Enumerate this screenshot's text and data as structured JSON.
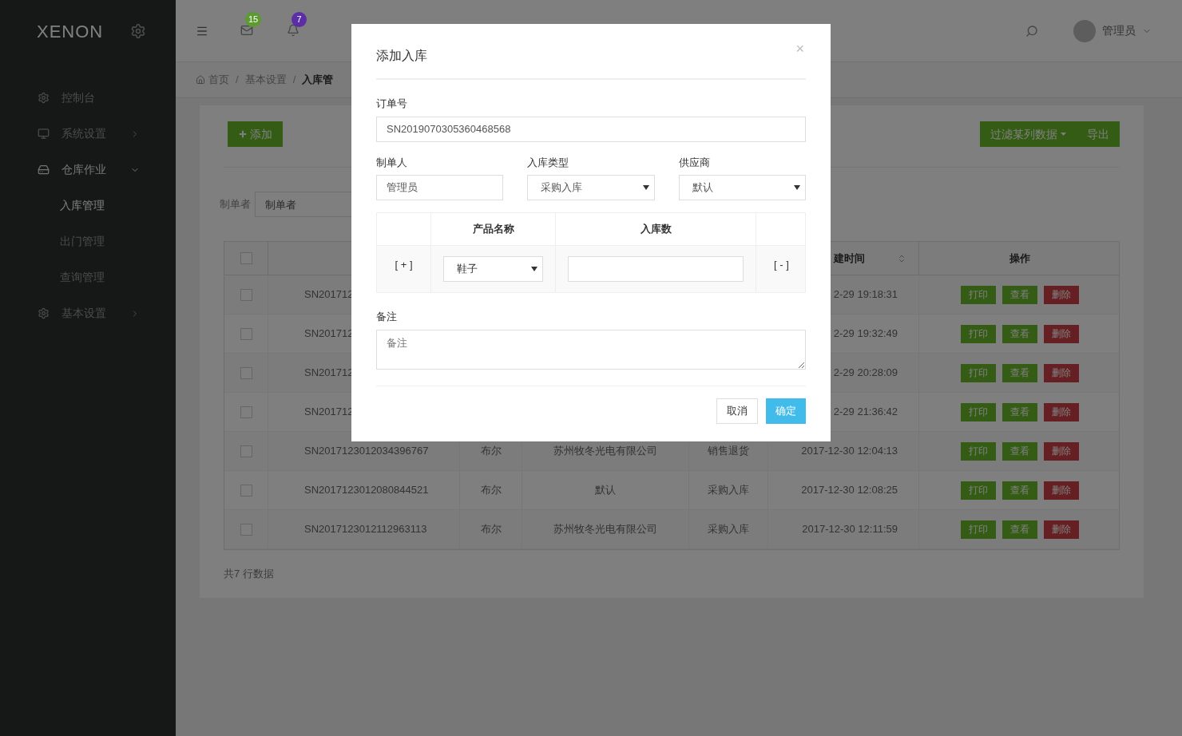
{
  "sidebar": {
    "logo": "XENON",
    "items": [
      {
        "label": "控制台",
        "kind": "gear"
      },
      {
        "label": "系统设置",
        "kind": "monitor",
        "expanded": false
      },
      {
        "label": "仓库作业",
        "kind": "drive",
        "expanded": true,
        "children": [
          {
            "label": "入库管理",
            "selected": true
          },
          {
            "label": "出门管理",
            "selected": false
          },
          {
            "label": "查询管理",
            "selected": false
          }
        ]
      },
      {
        "label": "基本设置",
        "kind": "gear",
        "expanded": false
      }
    ]
  },
  "topbar": {
    "badges": [
      {
        "kind": "mail",
        "count": "15",
        "color": "#5e9a32"
      },
      {
        "kind": "bell",
        "count": "7",
        "color": "#5b2ea6"
      }
    ],
    "user": "管理员"
  },
  "breadcrumb": [
    {
      "label": "首页",
      "current": false
    },
    {
      "separator": "/",
      "label": "基本设置",
      "current": false
    },
    {
      "separator": "/",
      "label": "入库管",
      "current": true
    }
  ],
  "toolbar": {
    "add_button": "添加",
    "filter_button": "过滤某列数据",
    "export_button": "导出"
  },
  "filter": {
    "label": "制单者",
    "placeholder": "制单者"
  },
  "table": {
    "header_checked": false,
    "created_header": "建时间",
    "actions_header": "操作",
    "rows": [
      {
        "checked": false,
        "order_no": "SN201712",
        "created": "2-29 19:18:31",
        "actions": [
          {
            "label": "打印",
            "kind": "success"
          },
          {
            "label": "查看",
            "kind": "success"
          },
          {
            "label": "删除",
            "kind": "danger"
          }
        ]
      },
      {
        "checked": false,
        "order_no": "SN201712",
        "created": "2-29 19:32:49",
        "actions": [
          {
            "label": "打印",
            "kind": "success"
          },
          {
            "label": "查看",
            "kind": "success"
          },
          {
            "label": "删除",
            "kind": "danger"
          }
        ]
      },
      {
        "checked": false,
        "order_no": "SN201712",
        "created": "2-29 20:28:09",
        "actions": [
          {
            "label": "打印",
            "kind": "success"
          },
          {
            "label": "查看",
            "kind": "success"
          },
          {
            "label": "删除",
            "kind": "danger"
          }
        ]
      },
      {
        "checked": false,
        "order_no": "SN201712",
        "created": "2-29 21:36:42",
        "actions": [
          {
            "label": "打印",
            "kind": "success"
          },
          {
            "label": "查看",
            "kind": "success"
          },
          {
            "label": "删除",
            "kind": "danger"
          }
        ]
      },
      {
        "checked": false,
        "order_no": "SN2017123012034396767",
        "maker": "布尔",
        "supplier": "苏州牧冬光电有限公司",
        "type": "销售退货",
        "created": "2017-12-30 12:04:13",
        "actions": [
          {
            "label": "打印",
            "kind": "success"
          },
          {
            "label": "查看",
            "kind": "success"
          },
          {
            "label": "删除",
            "kind": "danger"
          }
        ]
      },
      {
        "checked": false,
        "order_no": "SN2017123012080844521",
        "maker": "布尔",
        "supplier": "默认",
        "type": "采购入库",
        "created": "2017-12-30 12:08:25",
        "actions": [
          {
            "label": "打印",
            "kind": "success"
          },
          {
            "label": "查看",
            "kind": "success"
          },
          {
            "label": "删除",
            "kind": "danger"
          }
        ]
      },
      {
        "checked": false,
        "order_no": "SN2017123012112963113",
        "maker": "布尔",
        "supplier": "苏州牧冬光电有限公司",
        "type": "采购入库",
        "created": "2017-12-30 12:11:59",
        "actions": [
          {
            "label": "打印",
            "kind": "success"
          },
          {
            "label": "查看",
            "kind": "success"
          },
          {
            "label": "删除",
            "kind": "danger"
          }
        ]
      }
    ],
    "footer": "共7 行数据"
  },
  "modal": {
    "title": "添加入库",
    "close": "×",
    "order_no": {
      "label": "订单号",
      "value": "SN2019070305360468568"
    },
    "maker": {
      "label": "制单人",
      "value": "管理员"
    },
    "in_type": {
      "label": "入库类型",
      "value": "采购入库"
    },
    "supplier": {
      "label": "供应商",
      "value": "默认"
    },
    "items_table": {
      "columns": [
        "产品名称",
        "入库数"
      ],
      "rows": [
        {
          "add": "[ + ]",
          "product": "鞋子",
          "remove": "[ - ]"
        }
      ]
    },
    "remark": {
      "label": "备注",
      "placeholder": "备注"
    },
    "buttons": [
      {
        "label": "取消",
        "kind": "default"
      },
      {
        "label": "确定",
        "kind": "primary"
      }
    ]
  }
}
